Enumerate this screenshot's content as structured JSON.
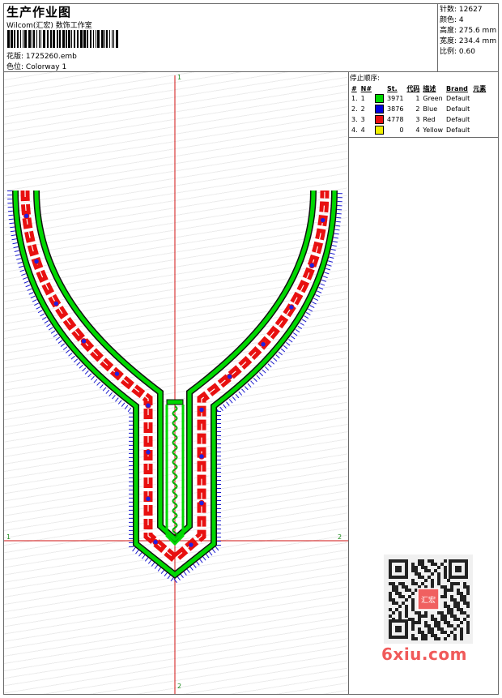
{
  "header": {
    "title": "生产作业图",
    "company": "Wilcom(汇宏) 数饰工作室",
    "file_label": "花版:",
    "file_name": "1725260.emb",
    "colorway_label": "色位:",
    "colorway": "Colorway 1"
  },
  "stats": [
    {
      "label": "针数:",
      "value": "12627"
    },
    {
      "label": "颜色:",
      "value": "4"
    },
    {
      "label": "高度:",
      "value": "275.6 mm"
    },
    {
      "label": "宽度:",
      "value": "234.4 mm"
    },
    {
      "label": "比例:",
      "value": "0.60"
    }
  ],
  "stop_sequence": {
    "title": "停止顺序:",
    "columns": [
      "#",
      "N#",
      "St.",
      "代码",
      "描述",
      "Brand",
      "元素"
    ],
    "rows": [
      {
        "index": "1.",
        "n": "1",
        "color": "#00d800",
        "stitches": "3971",
        "code": "1",
        "desc": "Green",
        "brand": "Default"
      },
      {
        "index": "2.",
        "n": "2",
        "color": "#0000e0",
        "stitches": "3876",
        "code": "2",
        "desc": "Blue",
        "brand": "Default"
      },
      {
        "index": "3.",
        "n": "3",
        "color": "#e81010",
        "stitches": "4778",
        "code": "3",
        "desc": "Red",
        "brand": "Default"
      },
      {
        "index": "4.",
        "n": "4",
        "color": "#f0f000",
        "stitches": "0",
        "code": "4",
        "desc": "Yellow",
        "brand": "Default"
      }
    ]
  },
  "axes": {
    "top": "1",
    "bottom": "2",
    "left": "1",
    "right": "2"
  },
  "watermark": {
    "site": "6xiu.com",
    "qr_text": "汇宏"
  },
  "colors": {
    "green": "#00d800",
    "blue": "#0000e0",
    "red": "#e81010",
    "axis": "#d01010"
  }
}
